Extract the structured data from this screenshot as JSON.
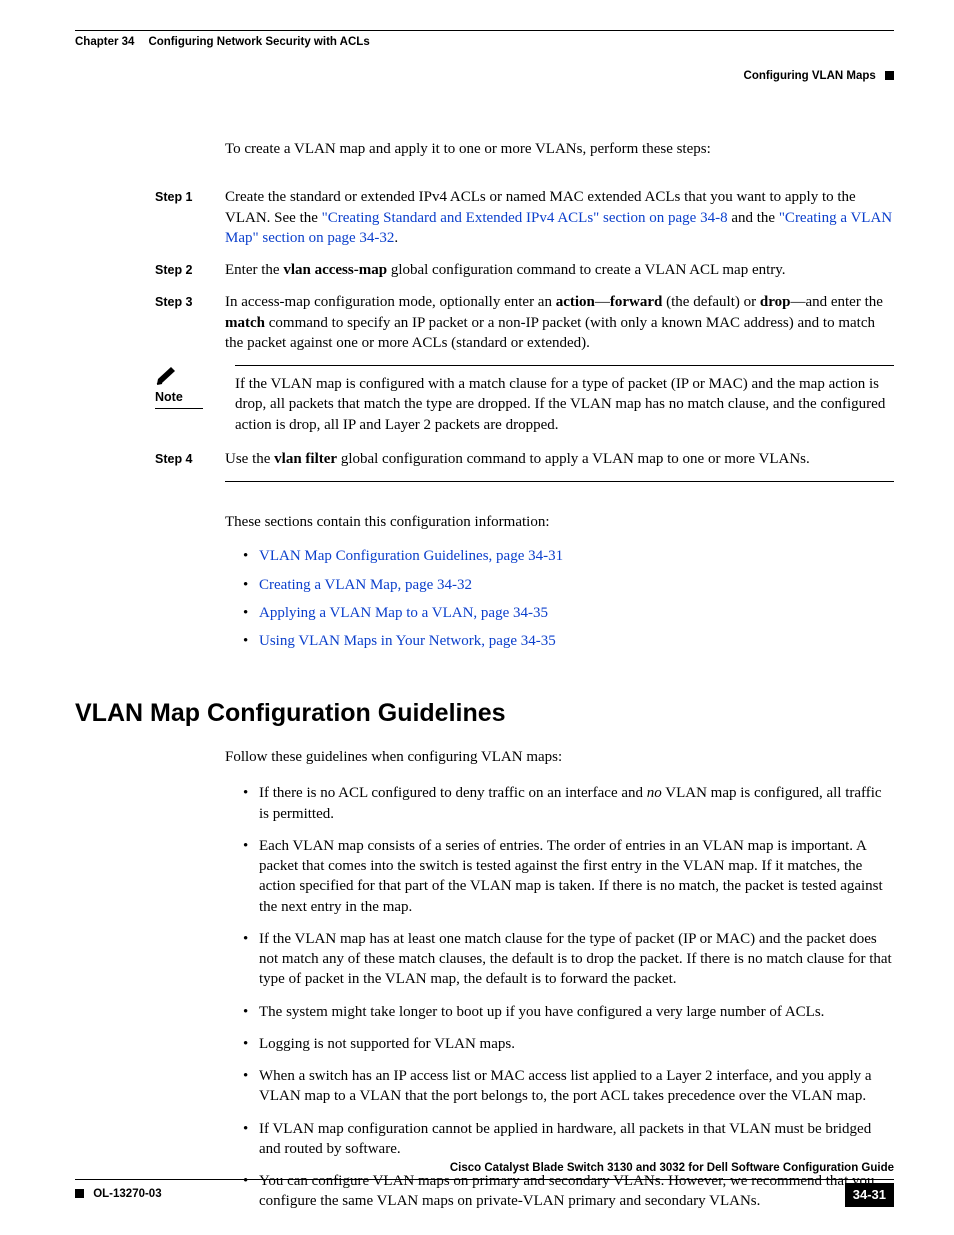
{
  "header": {
    "chapter": "Chapter 34",
    "title": "Configuring Network Security with ACLs",
    "section": "Configuring VLAN Maps"
  },
  "intro": "To create a VLAN map and apply it to one or more VLANs, perform these steps:",
  "steps": {
    "s1_label": "Step 1",
    "s1_a": "Create the standard or extended IPv4 ACLs or named MAC extended ACLs that you want to apply to the VLAN. See the ",
    "s1_link1": "\"Creating Standard and Extended IPv4 ACLs\" section on page 34-8",
    "s1_b": " and the ",
    "s1_link2": "\"Creating a VLAN Map\" section on page 34-32",
    "s1_c": ".",
    "s2_label": "Step 2",
    "s2_a": "Enter the ",
    "s2_bold": "vlan access-map",
    "s2_b": " global configuration command to create a VLAN ACL map entry.",
    "s3_label": "Step 3",
    "s3_a": "In access-map configuration mode, optionally enter an ",
    "s3_b1": "action",
    "s3_b": "—",
    "s3_b2": "forward",
    "s3_c": " (the default) or ",
    "s3_b3": "drop",
    "s3_d": "—and enter the ",
    "s3_b4": "match",
    "s3_e": " command to specify an IP packet or a non-IP packet (with only a known MAC address) and to match the packet against one or more ACLs (standard or extended).",
    "s4_label": "Step 4",
    "s4_a": "Use the ",
    "s4_bold": "vlan filter",
    "s4_b": " global configuration command to apply a VLAN map to one or more VLANs."
  },
  "note": {
    "label": "Note",
    "text": "If the VLAN map is configured with a match clause for a type of packet (IP or MAC) and the map action is drop, all packets that match the type are dropped. If the VLAN map has no match clause, and the configured action is drop, all IP and Layer 2 packets are dropped."
  },
  "sections_intro": "These sections contain this configuration information:",
  "section_links": [
    "VLAN Map Configuration Guidelines, page 34-31",
    "Creating a VLAN Map, page 34-32",
    "Applying a VLAN Map to a VLAN, page 34-35",
    "Using VLAN Maps in Your Network, page 34-35"
  ],
  "heading": "VLAN Map Configuration Guidelines",
  "guide_intro": "Follow these guidelines when configuring VLAN maps:",
  "guidelines": {
    "g1_a": "If there is no ACL configured to deny traffic on an interface and ",
    "g1_it": "no",
    "g1_b": " VLAN map is configured, all traffic is permitted.",
    "g2": "Each VLAN map consists of a series of entries. The order of entries in an VLAN map is important. A packet that comes into the switch is tested against the first entry in the VLAN map. If it matches, the action specified for that part of the VLAN map is taken. If there is no match, the packet is tested against the next entry in the map.",
    "g3": "If the VLAN map has at least one match clause for the type of packet (IP or MAC) and the packet does not match any of these match clauses, the default is to drop the packet. If there is no match clause for that type of packet in the VLAN map, the default is to forward the packet.",
    "g4": "The system might take longer to boot up if you have configured a very large number of ACLs.",
    "g5": "Logging is not supported for VLAN maps.",
    "g6": "When a switch has an IP access list or MAC access list applied to a Layer 2 interface, and you apply a VLAN map to a VLAN that the port belongs to, the port ACL takes precedence over the VLAN map.",
    "g7": "If VLAN map configuration cannot be applied in hardware, all packets in that VLAN must be bridged and routed by software.",
    "g8": "You can configure VLAN maps on primary and secondary VLANs. However, we recommend that you configure the same VLAN maps on private-VLAN primary and secondary VLANs."
  },
  "footer": {
    "book": "Cisco Catalyst Blade Switch 3130 and 3032 for Dell Software Configuration Guide",
    "doc": "OL-13270-03",
    "page": "34-31"
  }
}
